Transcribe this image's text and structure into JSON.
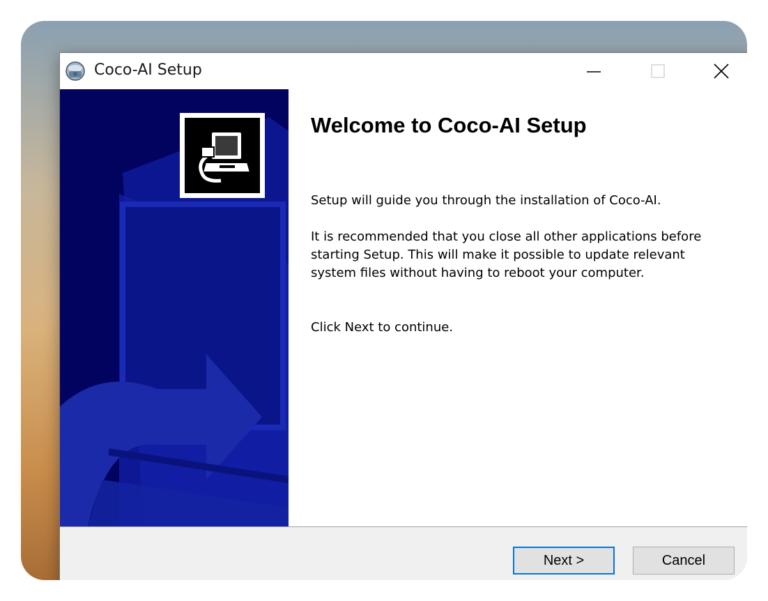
{
  "window": {
    "title": "Coco-AI Setup",
    "app_icon": "installer-globe-icon",
    "controls": {
      "minimize_icon": "minimize-icon",
      "maximize_icon": "maximize-icon",
      "close_icon": "close-icon"
    }
  },
  "sidebar": {
    "icon": "computer-install-icon",
    "background_color": "#02035f",
    "art_color": "#1a2aa8"
  },
  "main": {
    "heading": "Welcome to Coco-AI Setup",
    "paragraph_1": "Setup will guide you through the installation of Coco-AI.",
    "paragraph_2": "It is recommended that you close all other applications before starting Setup. This will make it possible to update relevant system files without having to reboot your computer.",
    "paragraph_3": "Click Next to continue."
  },
  "footer": {
    "next_label": "Next >",
    "cancel_label": "Cancel",
    "focus_color": "#0078d7"
  }
}
